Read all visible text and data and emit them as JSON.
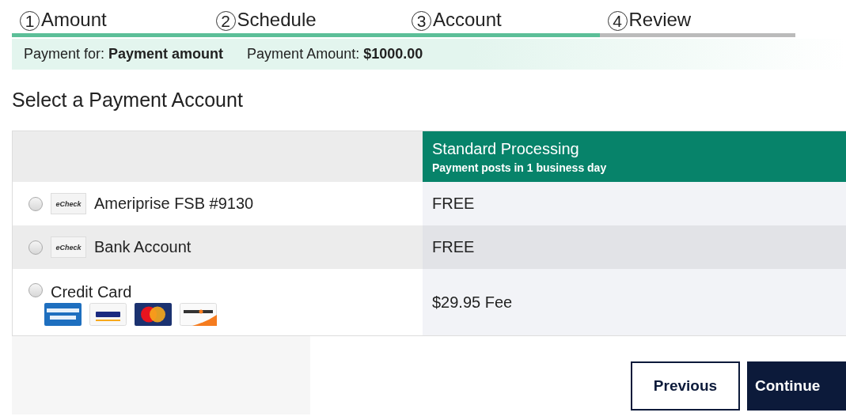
{
  "steps": [
    {
      "number": "1",
      "label": "Amount",
      "complete": true
    },
    {
      "number": "2",
      "label": "Schedule",
      "complete": true
    },
    {
      "number": "3",
      "label": "Account",
      "complete": true
    },
    {
      "number": "4",
      "label": "Review",
      "complete": false
    }
  ],
  "summary": [
    {
      "label": "Payment for:",
      "value": "Payment amount"
    },
    {
      "label": "Payment Amount:",
      "value": "$1000.00"
    }
  ],
  "heading": "Select a Payment Account",
  "table": {
    "column_header": {
      "title": "Standard Processing",
      "subtitle": "Payment posts in 1 business day"
    },
    "rows": [
      {
        "kind": "echeck",
        "badge": "eCheck",
        "label": "Ameriprise FSB #9130",
        "fee": "FREE",
        "selected": false
      },
      {
        "kind": "echeck",
        "badge": "eCheck",
        "label": "Bank Account",
        "fee": "FREE",
        "selected": false
      },
      {
        "kind": "card",
        "label": "Credit Card",
        "fee": "$29.95 Fee",
        "selected": false
      }
    ]
  },
  "buttons": [
    {
      "label": "Previous",
      "kind": "secondary"
    },
    {
      "label": "Continue",
      "kind": "primary"
    }
  ]
}
